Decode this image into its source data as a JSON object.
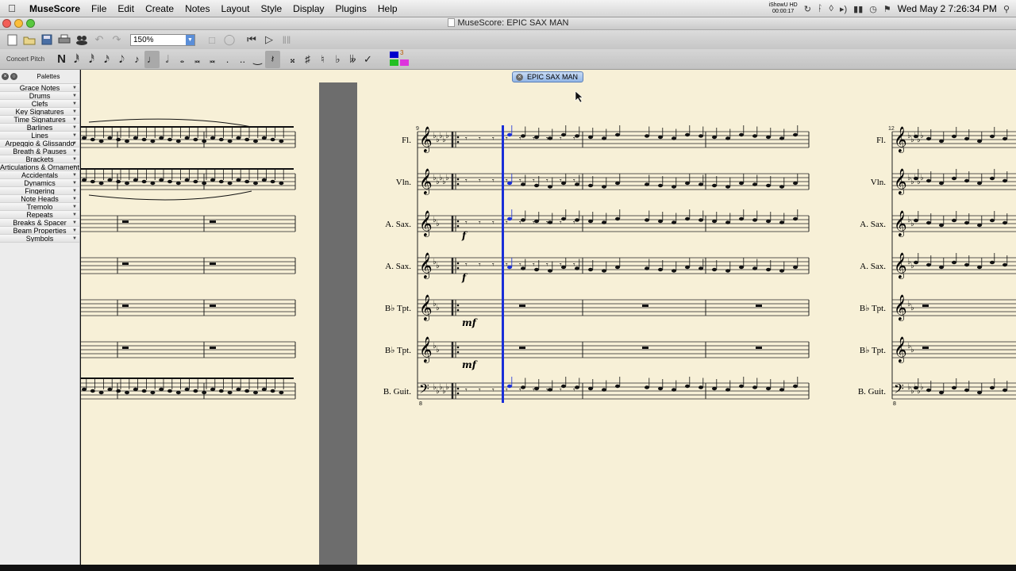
{
  "menubar": {
    "app_name": "MuseScore",
    "items": [
      "File",
      "Edit",
      "Create",
      "Notes",
      "Layout",
      "Style",
      "Display",
      "Plugins",
      "Help"
    ],
    "record_label_1": "iShowU HD",
    "record_label_2": "00:00:17",
    "clock": "Wed May 2  7:26:34 PM"
  },
  "window": {
    "title": "MuseScore: EPIC SAX MAN"
  },
  "toolbar": {
    "zoom_value": "150%",
    "concert_pitch_label": "Concert Pitch",
    "voice_label": "3"
  },
  "palettes": {
    "title": "Palettes",
    "items": [
      "Grace Notes",
      "Drums",
      "Clefs",
      "Key Signatures",
      "Time Signatures",
      "Barlines",
      "Lines",
      "Arpeggio & Glissando",
      "Breath & Pauses",
      "Brackets",
      "Articulations & Ornaments",
      "Accidentals",
      "Dynamics",
      "Fingering",
      "Note Heads",
      "Tremolo",
      "Repeats",
      "Breaks & Spacer",
      "Beam Properties",
      "Symbols"
    ]
  },
  "score": {
    "tab_title": "EPIC SAX MAN",
    "system_measure_number_1": "9",
    "system_measure_number_2": "12",
    "instruments": [
      "Fl.",
      "Vln.",
      "A. Sax.",
      "A. Sax.",
      "B♭ Tpt.",
      "B♭ Tpt.",
      "B. Guit."
    ],
    "dynamics": [
      "f",
      "f",
      "mf",
      "mf"
    ],
    "octave_mark": "8",
    "selection_color": "#1a2fd8"
  }
}
